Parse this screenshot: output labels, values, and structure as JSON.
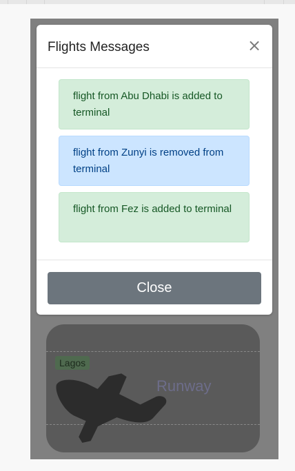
{
  "modal": {
    "title": "Flights Messages",
    "close_glyph": "×",
    "messages": [
      {
        "text": "flight from Abu Dhabi is added to terminal",
        "variant": "success"
      },
      {
        "text": "flight from Zunyi is removed from terminal",
        "variant": "info"
      },
      {
        "text": "flight from Fez is added to terminal",
        "variant": "success"
      }
    ],
    "close_button_label": "Close"
  },
  "background": {
    "city_badge": "Lagos",
    "runway_text": "Runway",
    "plane_icon": "airplane-icon"
  },
  "colors": {
    "success_bg": "#d4edda",
    "info_bg": "#cce5ff",
    "secondary_button": "#6c757d",
    "backdrop": "#808080"
  }
}
